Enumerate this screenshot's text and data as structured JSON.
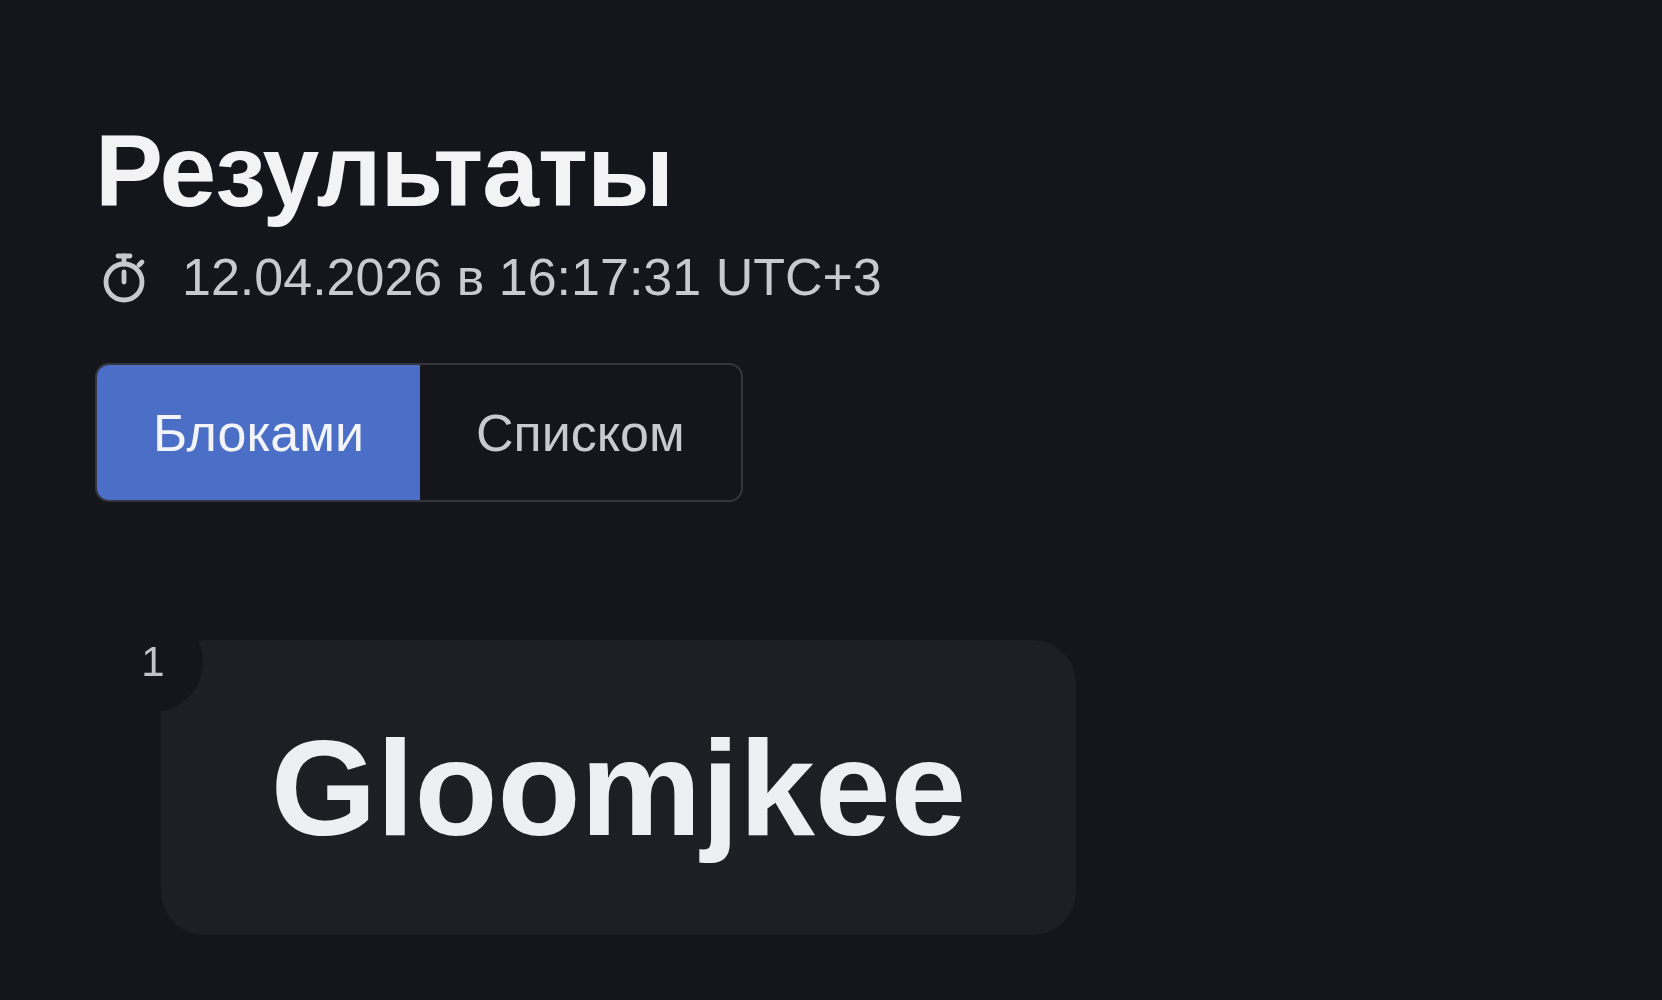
{
  "title": "Результаты",
  "timestamp": "12.04.2026 в 16:17:31 UTC+3",
  "view_toggle": [
    {
      "label": "Блоками",
      "selected": true
    },
    {
      "label": "Списком",
      "selected": false
    }
  ],
  "results": [
    {
      "rank": "1",
      "name": "Gloomjkee"
    }
  ]
}
